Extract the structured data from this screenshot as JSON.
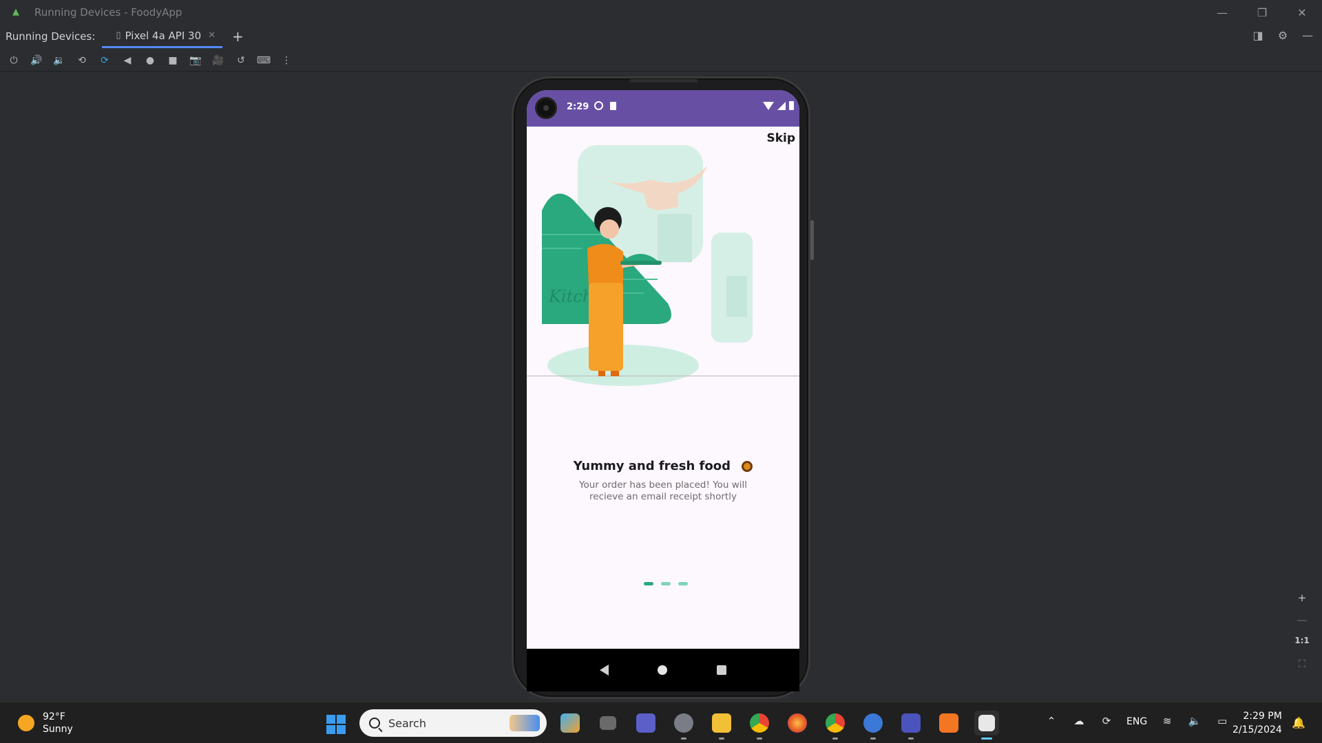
{
  "window": {
    "title": "Running Devices - FoodyApp",
    "controls": {
      "minimize": "—",
      "restore": "❐",
      "close": "✕"
    }
  },
  "tabs": {
    "section_label": "Running Devices:",
    "active_tab": "Pixel 4a API 30",
    "close_glyph": "✕",
    "add_glyph": "+"
  },
  "panel_icons": [
    "◨",
    "⚙",
    "—"
  ],
  "toolbar": {
    "buttons": [
      {
        "name": "power-icon",
        "glyph": "⏻"
      },
      {
        "name": "volume-up-icon",
        "glyph": "🔊"
      },
      {
        "name": "volume-down-icon",
        "glyph": "🔉"
      },
      {
        "name": "rotate-left-icon",
        "glyph": "⟲"
      },
      {
        "name": "rotate-right-icon",
        "glyph": "⟳"
      },
      {
        "name": "back-icon",
        "glyph": "◀"
      },
      {
        "name": "home-icon",
        "glyph": "●"
      },
      {
        "name": "overview-icon",
        "glyph": "■"
      },
      {
        "name": "screenshot-icon",
        "glyph": "📷"
      },
      {
        "name": "screen-record-icon",
        "glyph": "🎥"
      },
      {
        "name": "snapshot-icon",
        "glyph": "↺"
      },
      {
        "name": "keyboard-icon",
        "glyph": "⌨"
      },
      {
        "name": "more-icon",
        "glyph": "⋮"
      }
    ]
  },
  "device": {
    "status_time": "2:29",
    "skip_label": "Skip",
    "illustration_text": "Kitch",
    "headline": "Yummy and fresh food",
    "subtext": "Your order has been placed! You will recieve an email receipt shortly",
    "page_indicator": {
      "count": 3,
      "active": 0
    }
  },
  "zoom": {
    "in": "+",
    "out": "—",
    "actual": "1:1",
    "fit": "⛶"
  },
  "taskbar": {
    "weather_temp": "92°F",
    "weather_cond": "Sunny",
    "search_placeholder": "Search",
    "tray_lang": "ENG",
    "time": "2:29 PM",
    "date": "2/15/2024"
  },
  "colors": {
    "accent_purple": "#6750a4",
    "illustration_green": "#2aa87e",
    "character_orange": "#f08c1a"
  }
}
